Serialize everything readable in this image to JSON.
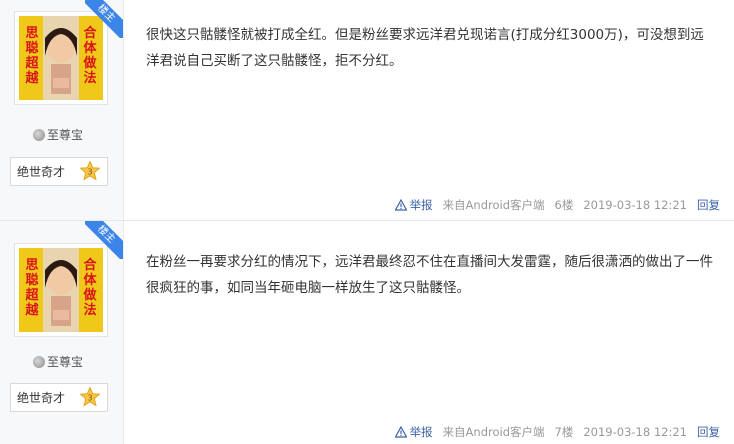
{
  "posts": [
    {
      "badge": "楼主",
      "level": "至尊宝",
      "title": "绝世奇才",
      "title_num": "3",
      "content": "很快这只骷髅怪就被打成全红。但是粉丝要求远洋君兑现诺言(打成分红3000万)，可没想到远洋君说自己买断了这只骷髅怪，拒不分红。",
      "report": "举报",
      "source": "来自Android客户端",
      "floor": "6楼",
      "time": "2019-03-18 12:21",
      "reply": "回复"
    },
    {
      "badge": "楼主",
      "level": "至尊宝",
      "title": "绝世奇才",
      "title_num": "3",
      "content": "在粉丝一再要求分红的情况下，远洋君最终忍不住在直播间大发雷霆，随后很潇洒的做出了一件很疯狂的事，如同当年砸电脑一样放生了这只骷髅怪。",
      "report": "举报",
      "source": "来自Android客户端",
      "floor": "7楼",
      "time": "2019-03-18 12:21",
      "reply": "回复"
    }
  ],
  "avatar": {
    "left_text": "思聪超越",
    "right_text": "合体做法",
    "colors": {
      "bg": "#f0c81a",
      "text": "#d8141b"
    }
  },
  "colors": {
    "link": "#3c63a8",
    "ribbon": "#3c85e8",
    "meta": "#999999"
  }
}
